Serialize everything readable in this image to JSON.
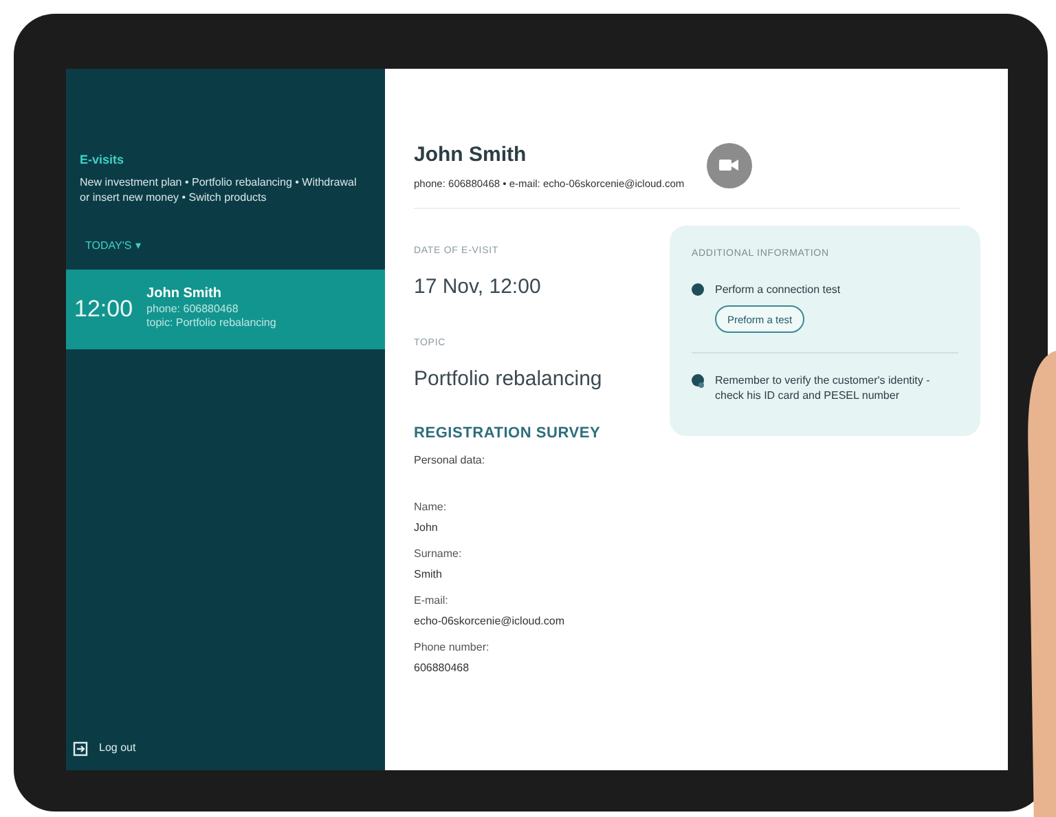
{
  "sidebar": {
    "title": "E-visits",
    "subtitle": "New investment plan • Portfolio rebalancing • Withdrawal or insert new money • Switch products",
    "filter": {
      "label": "TODAY'S",
      "icon": "▾"
    },
    "visits": [
      {
        "time": "12:00",
        "name": "John Smith",
        "phone_label": "phone:",
        "phone": "606880468",
        "topic_label": "topic:",
        "topic": "Portfolio rebalancing",
        "selected": true
      }
    ],
    "logout": "Log out"
  },
  "header": {
    "name": "John Smith",
    "contact": "phone: 606880468 • e-mail: echo-06skorcenie@icloud.com"
  },
  "details": [
    {
      "label": "DATE OF E-VISIT",
      "value": "17 Nov, 12:00"
    },
    {
      "label": "TOPIC",
      "value": "Portfolio rebalancing"
    }
  ],
  "info": {
    "title": "ADDITIONAL INFORMATION",
    "items": [
      {
        "kind": "test",
        "text": "Perform a connection test",
        "button": "Preform a test"
      },
      {
        "kind": "note",
        "text": "Remember to verify the customer's identity - check his ID card and PESEL number"
      }
    ]
  },
  "survey": {
    "title": "REGISTRATION SURVEY",
    "subtitle": "Personal data:",
    "fields": [
      {
        "label": "Name:",
        "value": "John"
      },
      {
        "label": "Surname:",
        "value": "Smith"
      },
      {
        "label": "E-mail:",
        "value": "echo-06skorcenie@icloud.com"
      },
      {
        "label": "Phone number:",
        "value": "606880468"
      }
    ]
  }
}
